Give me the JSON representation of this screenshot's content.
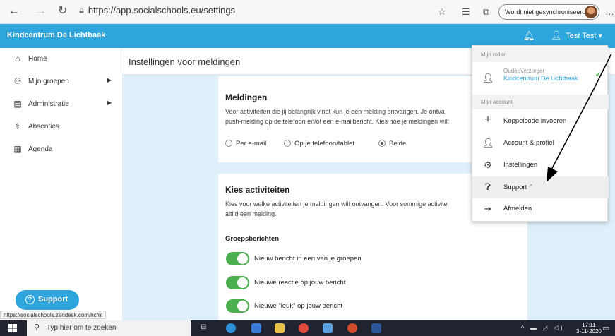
{
  "browser": {
    "back": "←",
    "forward": "→",
    "refresh": "↻",
    "url": "https://app.socialschools.eu/settings",
    "sync_label": "Wordt niet gesynchroniseerd",
    "icons": [
      "star-icon",
      "favorites-icon",
      "collections-icon",
      "more-icon"
    ]
  },
  "header": {
    "brand": "Kindcentrum De Lichtbaak",
    "user": "Test Test"
  },
  "sidebar": {
    "items": [
      {
        "label": "Home",
        "icon": "home-icon"
      },
      {
        "label": "Mijn groepen",
        "icon": "groups-icon",
        "has_arrow": true
      },
      {
        "label": "Administratie",
        "icon": "admin-icon",
        "has_arrow": true
      },
      {
        "label": "Absenties",
        "icon": "absences-icon"
      },
      {
        "label": "Agenda",
        "icon": "calendar-icon"
      }
    ],
    "support_label": "Support",
    "status_url": "https://socialschools.zendesk.com/hc/nl"
  },
  "main": {
    "title": "Instellingen voor meldingen",
    "meldingen": {
      "heading": "Meldingen",
      "desc_line1": "Voor activiteiten die jij belangrijk vindt kun je een melding ontvangen. Je ontva",
      "desc_line2": "push-melding op de telefoon en/of een e-mailbericht. Kies hoe je meldingen wilt",
      "options": [
        "Per e-mail",
        "Op je telefoon/tablet",
        "Beide"
      ],
      "selected": "Beide"
    },
    "activiteiten": {
      "heading": "Kies activiteiten",
      "desc_line1": "Kies voor welke activiteiten je meldingen wilt ontvangen. Voor sommige activite",
      "desc_line2": "altijd een melding.",
      "group_title": "Groepsberichten",
      "toggles": [
        {
          "label": "Nieuw bericht in een van je groepen",
          "on": true
        },
        {
          "label": "Nieuwe reactie op jouw bericht",
          "on": true
        },
        {
          "label": "Nieuwe \"leuk\" op jouw bericht",
          "on": true
        }
      ]
    }
  },
  "dropdown": {
    "roles_header": "Mijn rollen",
    "role_type": "Ouder/verzorger",
    "role_name": "Kindcentrum De Lichtbaak",
    "account_header": "Mijn account",
    "items": [
      {
        "label": "Koppelcode invoeren",
        "icon": "plus-icon"
      },
      {
        "label": "Account & profiel",
        "icon": "profile-icon"
      },
      {
        "label": "Instellingen",
        "icon": "gear-icon"
      },
      {
        "label": "Support",
        "icon": "help-icon"
      },
      {
        "label": "Afmelden",
        "icon": "logout-icon"
      }
    ]
  },
  "taskbar": {
    "search_placeholder": "Typ hier om te zoeken",
    "time": "17:11",
    "date": "3-11-2020"
  },
  "colors": {
    "accent": "#2ea5dc",
    "toggle_on": "#4caf50",
    "main_bg": "#dff0fa",
    "taskbar": "#1f2430"
  }
}
